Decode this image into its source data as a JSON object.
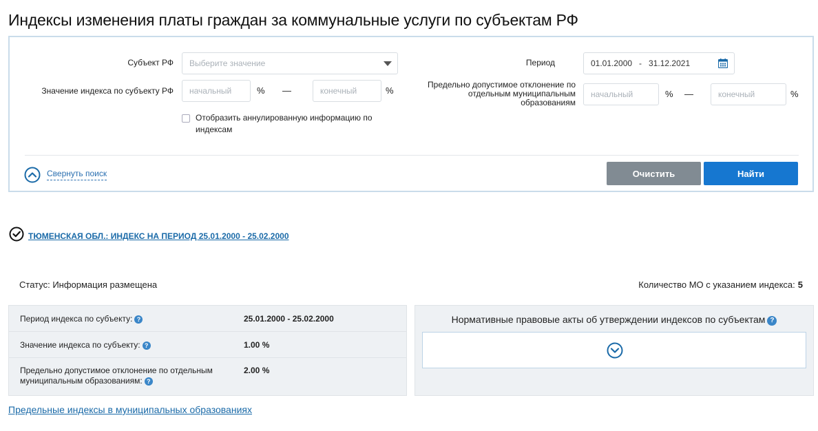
{
  "page": {
    "title": "Индексы изменения платы граждан за коммунальные услуги по субъектам РФ"
  },
  "search": {
    "subject_label": "Субъект РФ",
    "subject_placeholder": "Выберите значение",
    "index_label": "Значение индекса по субъекту РФ",
    "index_from_placeholder": "начальный",
    "index_to_placeholder": "конечный",
    "percent": "%",
    "dash": "—",
    "period_label": "Период",
    "period_value": "01.01.2000   -   31.12.2021",
    "deviation_label": "Предельно допустимое отклонение по отдельным муниципальным образованиям",
    "deviation_from_placeholder": "начальный",
    "deviation_to_placeholder": "конечный",
    "annulled_label": "Отобразить аннулированную информацию по индексам",
    "collapse_label": "Свернуть поиск",
    "clear_button": "Очистить",
    "find_button": "Найти"
  },
  "result": {
    "title": "ТЮМЕНСКАЯ ОБЛ.: ИНДЕКС НА ПЕРИОД 25.01.2000 - 25.02.2000",
    "status": "Статус: Информация размещена",
    "mo_count_label": "Количество МО с указанием индекса:",
    "mo_count_value": "5",
    "rows": [
      {
        "key": "Период индекса по субъекту:",
        "value": "25.01.2000 - 25.02.2000"
      },
      {
        "key": "Значение индекса по субъекту:",
        "value": "1.00 %"
      },
      {
        "key": "Предельно допустимое отклонение по отдельным муниципальным образованиям:",
        "value": "2.00 %"
      }
    ],
    "acts_title": "Нормативные правовые акты об утверждении индексов по субъектам",
    "help_mark": "?",
    "bottom_link": "Предельные индексы в муниципальных образованиях"
  },
  "colors": {
    "accent": "#1677d0",
    "link": "#1a6aa8",
    "neutral_button": "#818b93",
    "panel_border": "#c9dcea"
  },
  "icons": [
    "calendar-icon",
    "chevron-up-circle-icon",
    "check-circle-icon",
    "question-icon",
    "chevron-down-circle-icon"
  ]
}
